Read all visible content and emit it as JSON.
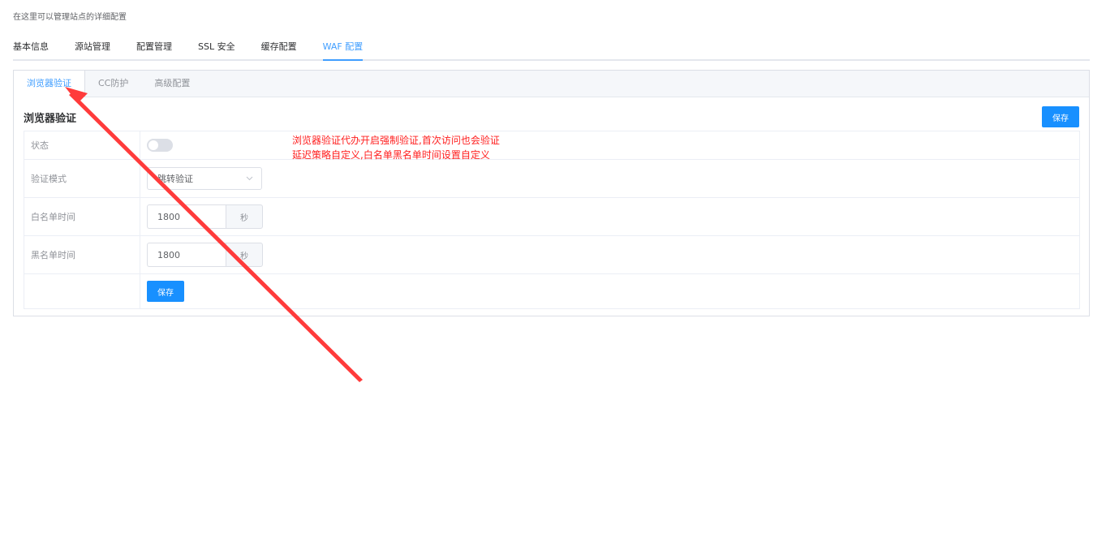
{
  "header": {
    "subtitle": "在这里可以管理站点的详细配置",
    "tabs": [
      {
        "label": "基本信息",
        "active": false
      },
      {
        "label": "源站管理",
        "active": false
      },
      {
        "label": "配置管理",
        "active": false
      },
      {
        "label": "SSL 安全",
        "active": false
      },
      {
        "label": "缓存配置",
        "active": false
      },
      {
        "label": "WAF 配置",
        "active": true
      }
    ]
  },
  "waf": {
    "sub_tabs": [
      {
        "label": "浏览器验证",
        "active": true
      },
      {
        "label": "CC防护",
        "active": false
      },
      {
        "label": "高级配置",
        "active": false
      }
    ],
    "section_title": "浏览器验证",
    "save_label": "保存",
    "form": {
      "status_label": "状态",
      "status_on": false,
      "mode_label": "验证模式",
      "mode_value": "跳转验证",
      "whitelist_label": "白名单时间",
      "whitelist_value": "1800",
      "blacklist_label": "黑名单时间",
      "blacklist_value": "1800",
      "unit": "秒",
      "submit_label": "保存"
    }
  },
  "annotation": {
    "line1": "浏览器验证代办开启强制验证,首次访问也会验证",
    "line2": "延迟策略自定义,白名单黑名单时间设置自定义",
    "color": "#ff2020"
  },
  "colors": {
    "accent": "#409eff",
    "button": "#1890ff"
  }
}
